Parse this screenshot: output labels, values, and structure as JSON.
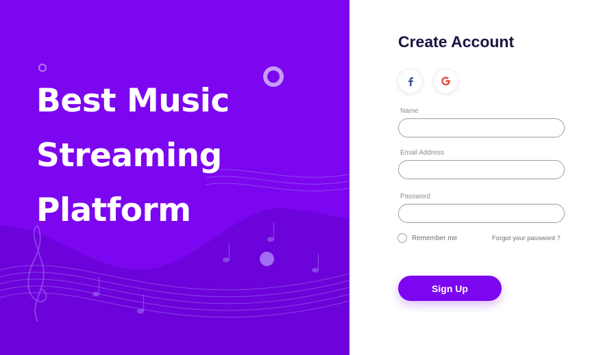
{
  "hero": {
    "lines": [
      "Best Music",
      "Streaming",
      "Platform"
    ]
  },
  "form": {
    "title": "Create Account",
    "social": [
      {
        "name": "facebook-icon",
        "glyph": "f"
      },
      {
        "name": "google-icon",
        "glyph": "G"
      }
    ],
    "fields": [
      {
        "label": "Name",
        "value": "",
        "placeholder": ""
      },
      {
        "label": "Email Address",
        "value": "",
        "placeholder": ""
      },
      {
        "label": "Password",
        "value": "",
        "placeholder": ""
      }
    ],
    "remember_label": "Remember me",
    "forgot_label": "Forgot your password ?",
    "submit_label": "Sign Up"
  },
  "colors": {
    "accent": "#7c06ef",
    "title": "#1b1340",
    "facebook": "#3b5998",
    "google": "#ea4335"
  }
}
